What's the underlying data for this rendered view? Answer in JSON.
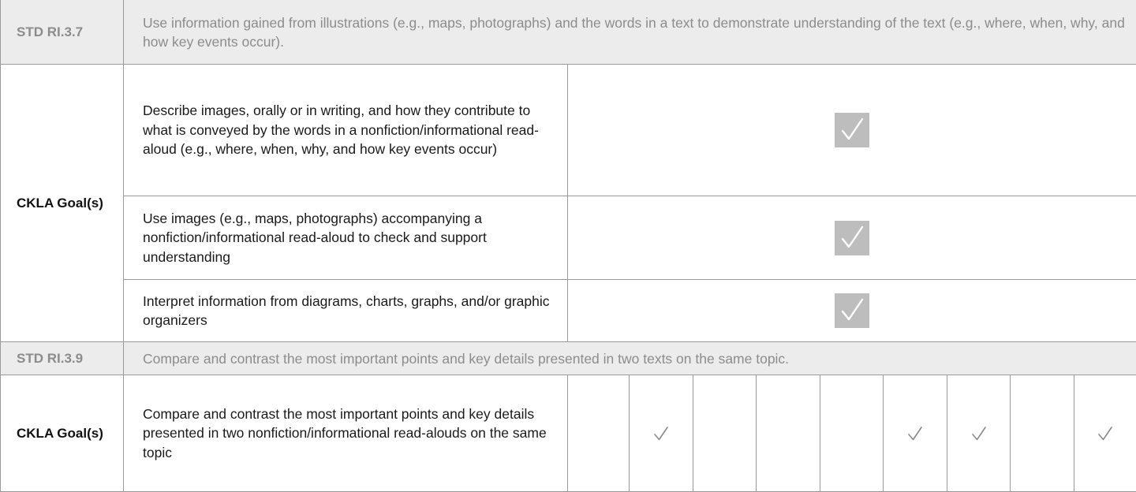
{
  "sections": [
    {
      "standard": {
        "label": "STD RI.3.7",
        "text": "Use information gained from illustrations (e.g., maps, photographs) and the words in a text to demonstrate understanding of the text (e.g., where, when, why, and how key events occur)."
      },
      "goals_label": "CKLA Goal(s)",
      "goals": [
        {
          "text": "Describe images, orally or in writing, and how they contribute to what is conveyed by the words in a nonfiction/informational read-aloud (e.g., where, when, why, and how key events occur)",
          "checked": true
        },
        {
          "text": "Use images (e.g., maps, photographs) accompanying a nonfiction/informational read-aloud to check and support understanding",
          "checked": true
        },
        {
          "text": "Interpret information from diagrams, charts, graphs, and/or graphic organizers",
          "checked": true
        }
      ]
    },
    {
      "standard": {
        "label": "STD RI.3.9",
        "text": "Compare and contrast the most important points and key details presented in two texts on the same topic."
      },
      "goals_label": "CKLA Goal(s)",
      "goals": [
        {
          "text": "Compare and contrast the most important points and key details presented in two nonfiction/informational read-alouds on the same topic",
          "columns_checked": [
            false,
            true,
            false,
            false,
            false,
            true,
            true,
            false,
            true
          ]
        }
      ]
    }
  ],
  "icons": {
    "shaded_check": "checkmark-icon",
    "plain_check": "checkmark-icon"
  },
  "colors": {
    "standard_row_bg": "#ececec",
    "standard_text": "#8c8c8c",
    "check_box_bg": "#bdbdbd",
    "check_mark": "#ffffff",
    "plain_check_mark": "#8a8a8a",
    "border": "#9a9a9a"
  }
}
